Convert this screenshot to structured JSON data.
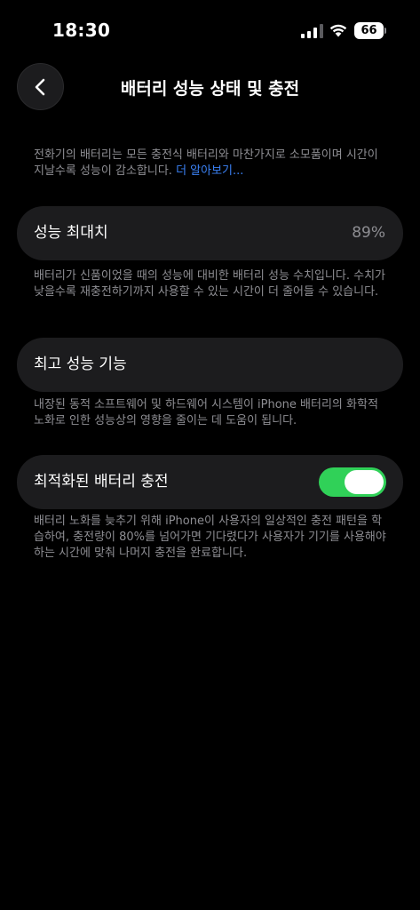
{
  "status_bar": {
    "time": "18:30",
    "battery_level": "66",
    "icons": [
      "signal-icon",
      "wifi-icon",
      "battery-icon"
    ]
  },
  "nav": {
    "back_icon": "chevron-left-icon",
    "title": "배터리 성능 상태 및 충전"
  },
  "intro": {
    "text": "전화기의 배터리는 모든 충전식 배터리와 마찬가지로 소모품이며 시간이 지날수록 성능이 감소합니다. ",
    "link": "더 알아보기..."
  },
  "max_capacity": {
    "label": "성능 최대치",
    "value": "89%",
    "description": "배터리가 신품이었을 때의 성능에 대비한 배터리 성능 수치입니다. 수치가 낮을수록 재충전하기까지 사용할 수 있는 시간이 더 줄어들 수 있습니다."
  },
  "peak_performance": {
    "label": "최고 성능 기능",
    "description": "내장된 동적 소프트웨어 및 하드웨어 시스템이 iPhone 배터리의 화학적 노화로 인한 성능상의 영향을 줄이는 데 도움이 됩니다."
  },
  "optimized_charging": {
    "label": "최적화된 배터리 충전",
    "enabled": true,
    "description": "배터리 노화를 늦추기 위해 iPhone이 사용자의 일상적인 충전 패턴을 학습하여, 충전량이 80%를 넘어가면 기다렸다가 사용자가 기기를 사용해야 하는 시간에 맞춰 나머지 충전을 완료합니다."
  },
  "colors": {
    "background": "#000000",
    "cell": "#1c1c1e",
    "secondary_text": "#8e8e93",
    "link": "#3b82f6",
    "toggle_on": "#30d158"
  }
}
